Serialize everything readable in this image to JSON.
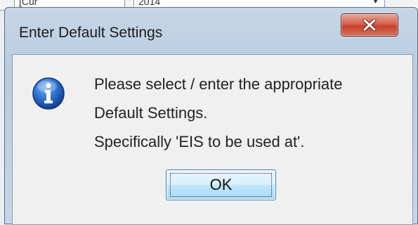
{
  "background_window": {
    "left_field_text": "[Cur",
    "right_field_text": "2014"
  },
  "dialog": {
    "title": "Enter Default Settings",
    "close_icon": "close-x-icon",
    "message_icon": "info-icon",
    "message_lines": [
      "Please select / enter the appropriate",
      "Default Settings.",
      "Specifically 'EIS to be used at'."
    ],
    "ok_label": "OK"
  },
  "colors": {
    "close_button_red": "#c8412c",
    "info_icon_blue": "#1f5fbf",
    "ok_button_border": "#3c7fb1"
  }
}
